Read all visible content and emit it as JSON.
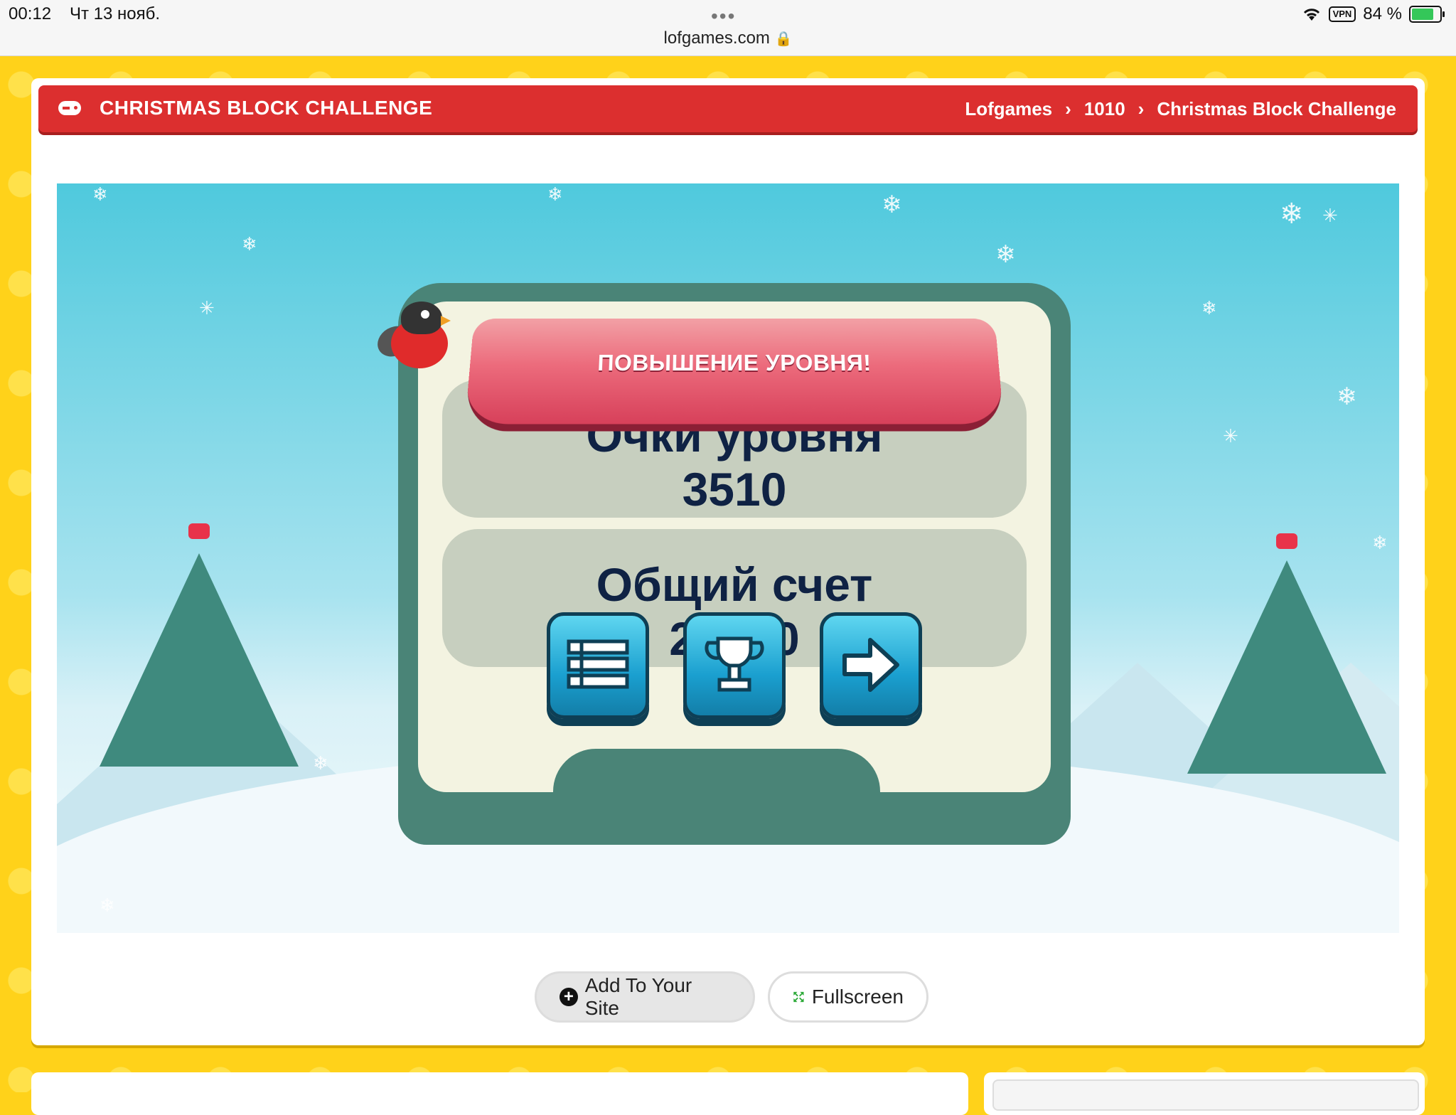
{
  "status_bar": {
    "time": "00:12",
    "date": "Чт 13 нояб.",
    "url": "lofgames.com",
    "vpn_label": "VPN",
    "battery": "84 %"
  },
  "header": {
    "title": "CHRISTMAS BLOCK CHALLENGE",
    "breadcrumb": [
      "Lofgames",
      "1010",
      "Christmas Block Challenge"
    ]
  },
  "game": {
    "ribbon_text": "ПОВЫШЕНИЕ УРОВНЯ!",
    "level_score_label": "Очки уровня",
    "level_score_value": "3510",
    "total_score_label": "Общий счет",
    "total_score_value": "20240",
    "buttons": [
      "menu-list",
      "trophy",
      "next-arrow"
    ]
  },
  "actions": {
    "add_to_site": "Add To Your Site",
    "fullscreen": "Fullscreen"
  },
  "colors": {
    "header_red": "#dc2f2f",
    "page_yellow": "#ffd21a",
    "panel_teal": "#4a8477",
    "score_text": "#0f2244"
  }
}
